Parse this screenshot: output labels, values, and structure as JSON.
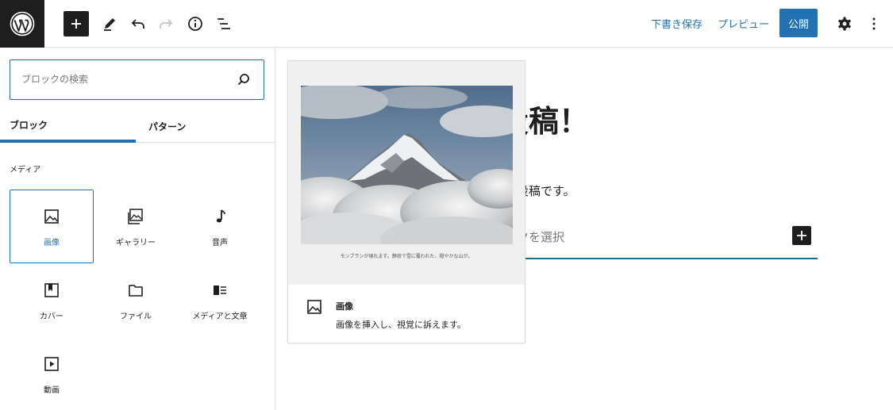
{
  "toolbar": {
    "save_draft": "下書き保存",
    "preview": "プレビュー",
    "publish": "公開",
    "accent_color": "#2271b1"
  },
  "inserter": {
    "search_placeholder": "ブロックの検索",
    "tabs": [
      "ブロック",
      "パターン"
    ],
    "active_tab": "ブロック",
    "category": "メディア",
    "blocks": [
      {
        "label": "画像",
        "icon": "image-icon",
        "selected": true
      },
      {
        "label": "ギャラリー",
        "icon": "gallery-icon",
        "selected": false
      },
      {
        "label": "音声",
        "icon": "audio-icon",
        "selected": false
      },
      {
        "label": "カバー",
        "icon": "cover-icon",
        "selected": false
      },
      {
        "label": "ファイル",
        "icon": "file-icon",
        "selected": false
      },
      {
        "label": "メディアと文章",
        "icon": "media-text-icon",
        "selected": false
      },
      {
        "label": "動画",
        "icon": "video-icon",
        "selected": false
      }
    ]
  },
  "editor": {
    "title_fragment": "投稿！",
    "paragraph_fragment": "の投稿です。",
    "appender_fragment": "ックを選択"
  },
  "preview": {
    "caption": "モンブランが現れます。静寂で雪に覆われた、穏やかな山が。",
    "block_title": "画像",
    "block_description": "画像を挿入し、視覚に訴えます。"
  }
}
